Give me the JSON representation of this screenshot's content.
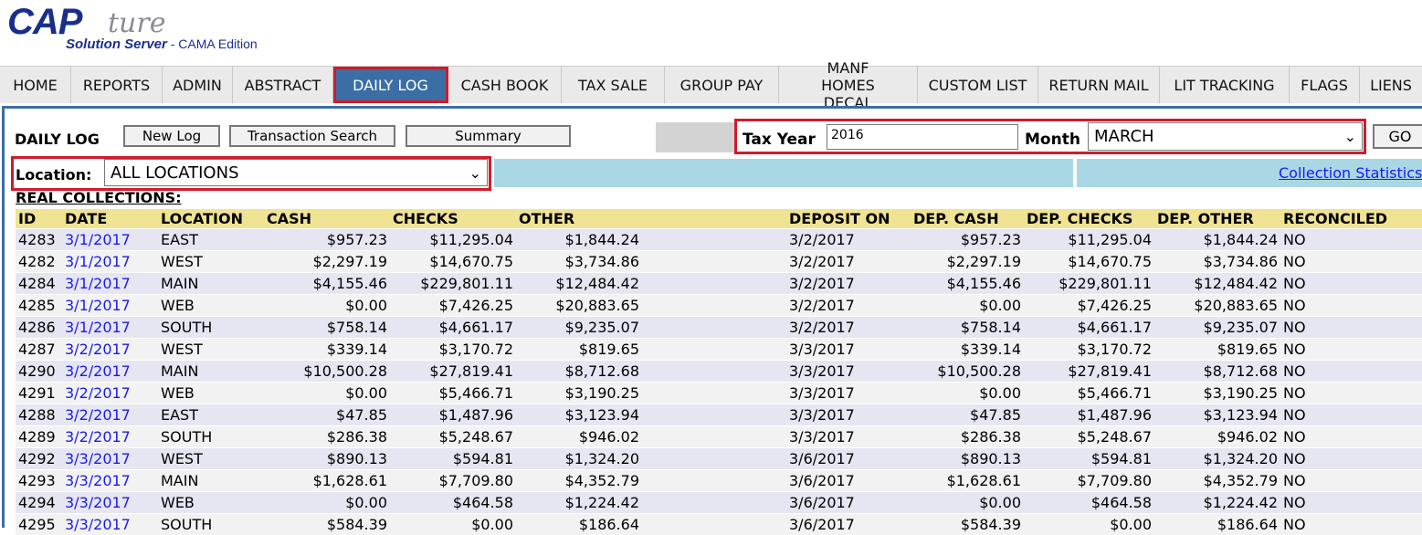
{
  "logo": {
    "cap": "CAP",
    "ture": "ture",
    "sub": "Solution Server",
    "sub2": " - CAMA Edition"
  },
  "nav": [
    {
      "label": "HOME"
    },
    {
      "label": "REPORTS"
    },
    {
      "label": "ADMIN"
    },
    {
      "label": "ABSTRACT"
    },
    {
      "label": "DAILY LOG"
    },
    {
      "label": "CASH BOOK"
    },
    {
      "label": "TAX SALE"
    },
    {
      "label": "GROUP PAY"
    },
    {
      "label": "MANF HOMES DECAL"
    },
    {
      "label": "CUSTOM LIST"
    },
    {
      "label": "RETURN MAIL"
    },
    {
      "label": "LIT TRACKING"
    },
    {
      "label": "FLAGS"
    },
    {
      "label": "LIENS"
    }
  ],
  "toolbar": {
    "title": "DAILY LOG",
    "new_log": "New Log",
    "transaction_search": "Transaction Search",
    "summary": "Summary",
    "tax_year_label": "Tax Year",
    "tax_year_value": "2016",
    "month_label": "Month",
    "month_value": "MARCH",
    "go": "GO",
    "location_label": "Location:",
    "location_value": "ALL LOCATIONS",
    "collection_statistics": "Collection Statistics"
  },
  "section_title": "REAL COLLECTIONS:",
  "table": {
    "headers": [
      "ID",
      "DATE",
      "LOCATION",
      "CASH",
      "CHECKS",
      "OTHER",
      "",
      "DEPOSIT ON",
      "DEP. CASH",
      "DEP. CHECKS",
      "DEP. OTHER",
      "RECONCILED"
    ],
    "rows": [
      [
        "4283",
        "3/1/2017",
        "EAST",
        "$957.23",
        "$11,295.04",
        "$1,844.24",
        "",
        "3/2/2017",
        "$957.23",
        "$11,295.04",
        "$1,844.24",
        "NO"
      ],
      [
        "4282",
        "3/1/2017",
        "WEST",
        "$2,297.19",
        "$14,670.75",
        "$3,734.86",
        "",
        "3/2/2017",
        "$2,297.19",
        "$14,670.75",
        "$3,734.86",
        "NO"
      ],
      [
        "4284",
        "3/1/2017",
        "MAIN",
        "$4,155.46",
        "$229,801.11",
        "$12,484.42",
        "",
        "3/2/2017",
        "$4,155.46",
        "$229,801.11",
        "$12,484.42",
        "NO"
      ],
      [
        "4285",
        "3/1/2017",
        "WEB",
        "$0.00",
        "$7,426.25",
        "$20,883.65",
        "",
        "3/2/2017",
        "$0.00",
        "$7,426.25",
        "$20,883.65",
        "NO"
      ],
      [
        "4286",
        "3/1/2017",
        "SOUTH",
        "$758.14",
        "$4,661.17",
        "$9,235.07",
        "",
        "3/2/2017",
        "$758.14",
        "$4,661.17",
        "$9,235.07",
        "NO"
      ],
      [
        "4287",
        "3/2/2017",
        "WEST",
        "$339.14",
        "$3,170.72",
        "$819.65",
        "",
        "3/3/2017",
        "$339.14",
        "$3,170.72",
        "$819.65",
        "NO"
      ],
      [
        "4290",
        "3/2/2017",
        "MAIN",
        "$10,500.28",
        "$27,819.41",
        "$8,712.68",
        "",
        "3/3/2017",
        "$10,500.28",
        "$27,819.41",
        "$8,712.68",
        "NO"
      ],
      [
        "4291",
        "3/2/2017",
        "WEB",
        "$0.00",
        "$5,466.71",
        "$3,190.25",
        "",
        "3/3/2017",
        "$0.00",
        "$5,466.71",
        "$3,190.25",
        "NO"
      ],
      [
        "4288",
        "3/2/2017",
        "EAST",
        "$47.85",
        "$1,487.96",
        "$3,123.94",
        "",
        "3/3/2017",
        "$47.85",
        "$1,487.96",
        "$3,123.94",
        "NO"
      ],
      [
        "4289",
        "3/2/2017",
        "SOUTH",
        "$286.38",
        "$5,248.67",
        "$946.02",
        "",
        "3/3/2017",
        "$286.38",
        "$5,248.67",
        "$946.02",
        "NO"
      ],
      [
        "4292",
        "3/3/2017",
        "WEST",
        "$890.13",
        "$594.81",
        "$1,324.20",
        "",
        "3/6/2017",
        "$890.13",
        "$594.81",
        "$1,324.20",
        "NO"
      ],
      [
        "4293",
        "3/3/2017",
        "MAIN",
        "$1,628.61",
        "$7,709.80",
        "$4,352.79",
        "",
        "3/6/2017",
        "$1,628.61",
        "$7,709.80",
        "$4,352.79",
        "NO"
      ],
      [
        "4294",
        "3/3/2017",
        "WEB",
        "$0.00",
        "$464.58",
        "$1,224.42",
        "",
        "3/6/2017",
        "$0.00",
        "$464.58",
        "$1,224.42",
        "NO"
      ],
      [
        "4295",
        "3/3/2017",
        "SOUTH",
        "$584.39",
        "$0.00",
        "$186.64",
        "",
        "3/6/2017",
        "$584.39",
        "$0.00",
        "$186.64",
        "NO"
      ]
    ]
  }
}
